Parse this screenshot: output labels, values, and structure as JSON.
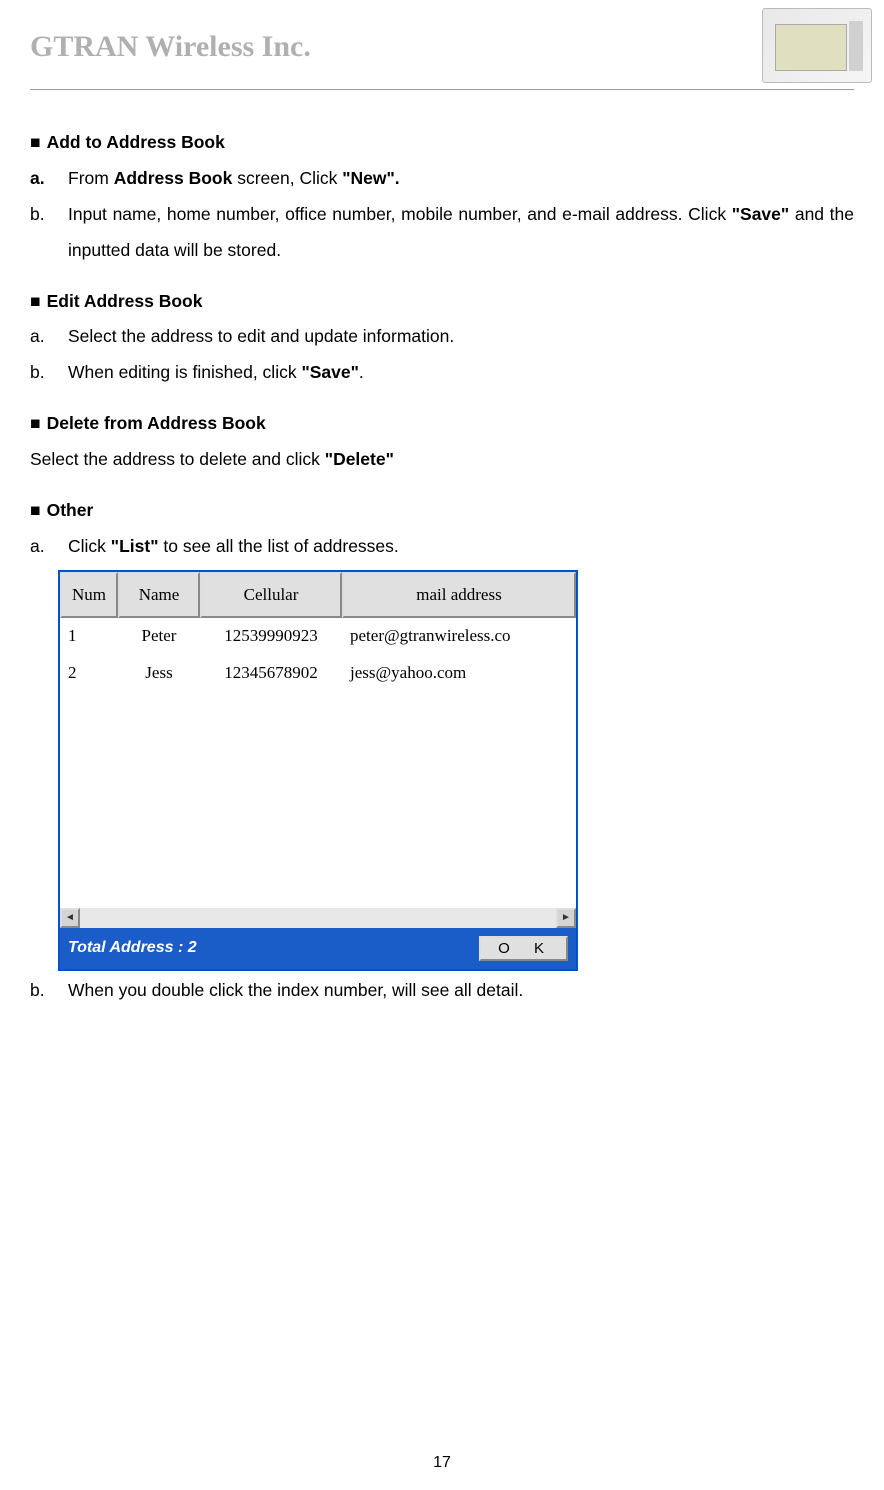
{
  "header": {
    "company": "GTRAN Wireless Inc."
  },
  "sections": {
    "add": {
      "heading": "Add to Address Book",
      "a_prefix": "From ",
      "a_bold1": "Address Book",
      "a_mid": " screen, Click ",
      "a_bold2": "\"New\".",
      "b_prefix": "Input name, home number, office number, mobile number, and e-mail address. Click ",
      "b_bold": "\"Save\"",
      "b_suffix": " and the inputted data will be stored."
    },
    "edit": {
      "heading": "Edit Address Book",
      "a": "Select the address to edit and update information.",
      "b_prefix": "When editing is finished, click ",
      "b_bold": "\"Save\"",
      "b_suffix": "."
    },
    "delete": {
      "heading": "Delete from Address Book",
      "text_prefix": "Select the address to delete and click ",
      "text_bold": "\"Delete\""
    },
    "other": {
      "heading": "Other",
      "a_prefix": "Click ",
      "a_bold": "\"List\"",
      "a_suffix": " to see all the list of addresses.",
      "b": "When you double click the index number, will see all detail."
    }
  },
  "table": {
    "headers": {
      "num": "Num",
      "name": "Name",
      "cellular": "Cellular",
      "mail": "mail address"
    },
    "rows": [
      {
        "num": "1",
        "name": "Peter",
        "cellular": "12539990923",
        "mail": "peter@gtranwireless.co"
      },
      {
        "num": "2",
        "name": "Jess",
        "cellular": "12345678902",
        "mail": "jess@yahoo.com"
      }
    ],
    "status": "Total Address : 2",
    "ok_label": "O  K"
  },
  "markers": {
    "a": "a.",
    "b": "b.",
    "a_bold": "a."
  },
  "page_number": "17"
}
